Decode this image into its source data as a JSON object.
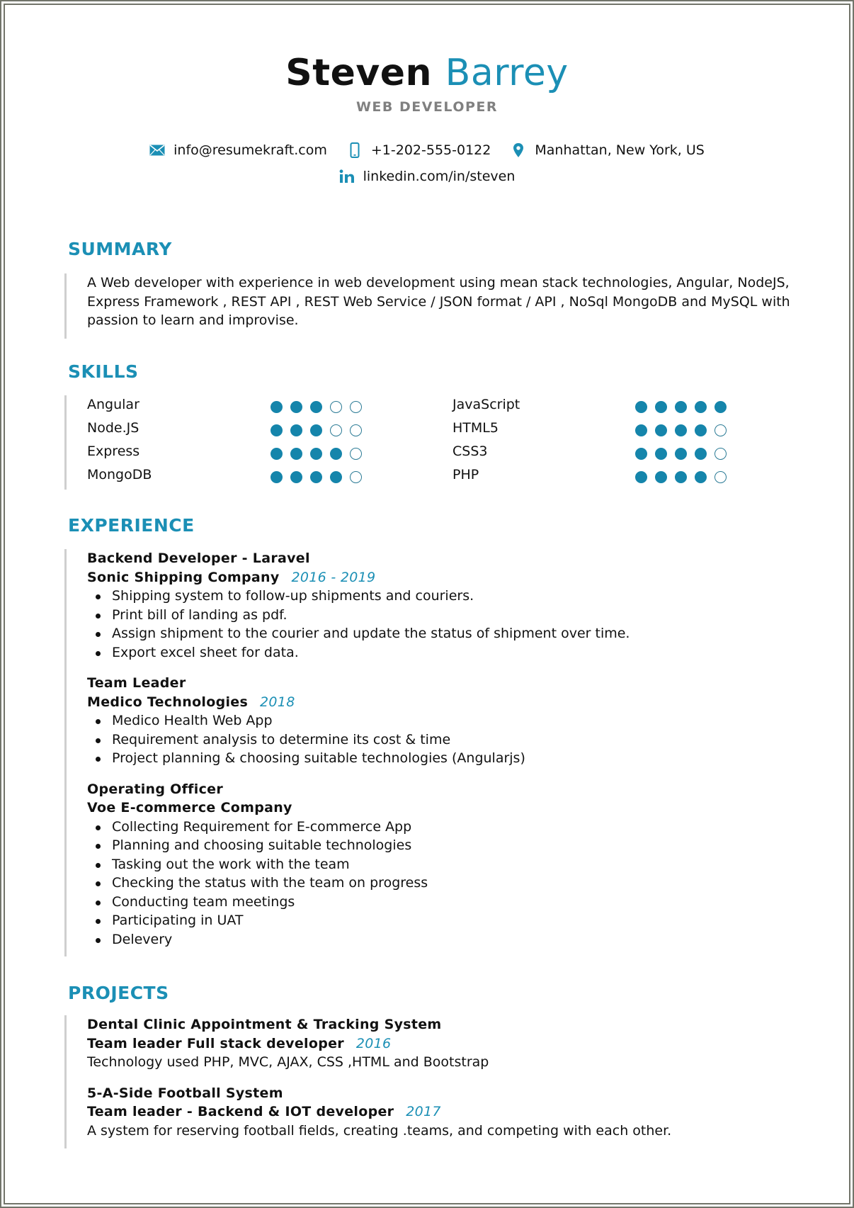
{
  "header": {
    "first_name": "Steven",
    "last_name": "Barrey",
    "role": "WEB DEVELOPER"
  },
  "contact": {
    "email": {
      "icon": "envelope-icon",
      "value": "info@resumekraft.com"
    },
    "phone": {
      "icon": "mobile-phone-icon",
      "value": "+1-202-555-0122"
    },
    "location": {
      "icon": "map-pin-icon",
      "value": "Manhattan, New York, US"
    },
    "linkedin": {
      "icon": "linkedin-icon",
      "value": "linkedin.com/in/steven"
    }
  },
  "colors": {
    "accent": "#1b8fb5",
    "dot_filled": "#1585ab",
    "role_gray": "#808080",
    "rule_gray": "#cfcfcf",
    "frame": "#72746a"
  },
  "summary": {
    "title": "SUMMARY",
    "text": "A Web developer with experience in web development using mean stack technologies, Angular, NodeJS, Express Framework , REST API , REST Web Service / JSON format / API , NoSql MongoDB and MySQL with passion to learn and improvise."
  },
  "skills": {
    "title": "SKILLS",
    "max_level": 5,
    "left": [
      {
        "name": "Angular",
        "level": 3
      },
      {
        "name": "Node.JS",
        "level": 3
      },
      {
        "name": "Express",
        "level": 4
      },
      {
        "name": "MongoDB",
        "level": 4
      }
    ],
    "right": [
      {
        "name": "JavaScript",
        "level": 5
      },
      {
        "name": "HTML5",
        "level": 4
      },
      {
        "name": "CSS3",
        "level": 4
      },
      {
        "name": "PHP",
        "level": 4
      }
    ]
  },
  "experience": {
    "title": "EXPERIENCE",
    "jobs": [
      {
        "title": "Backend Developer - Laravel",
        "company": "Sonic Shipping Company",
        "date": "2016 - 2019",
        "bullets": [
          "Shipping system to follow-up shipments and couriers.",
          "Print bill of landing as pdf.",
          "Assign shipment to the courier and update the status of shipment over time.",
          "Export excel sheet for data."
        ]
      },
      {
        "title": "Team Leader",
        "company": "Medico Technologies",
        "date": "2018",
        "bullets": [
          "Medico Health Web App",
          "Requirement analysis to determine its cost & time",
          "Project planning & choosing suitable technologies (Angularjs)"
        ]
      },
      {
        "title": "Operating Officer",
        "company": "Voe E-commerce Company",
        "date": "",
        "bullets": [
          "Collecting Requirement for E-commerce App",
          "Planning and choosing suitable technologies",
          "Tasking out the work with the team",
          "Checking the status with the team on progress",
          "Conducting team meetings",
          "Participating in UAT",
          "Delevery"
        ]
      }
    ]
  },
  "projects": {
    "title": "PROJECTS",
    "items": [
      {
        "name": "Dental Clinic Appointment & Tracking System",
        "role": "Team leader Full stack developer",
        "date": "2016",
        "description": "Technology used PHP, MVC, AJAX, CSS ,HTML and Bootstrap"
      },
      {
        "name": "5-A-Side Football System",
        "role": "Team leader - Backend & IOT developer",
        "date": "2017",
        "description": "A system for reserving football fields, creating .teams, and competing with each other."
      }
    ]
  }
}
